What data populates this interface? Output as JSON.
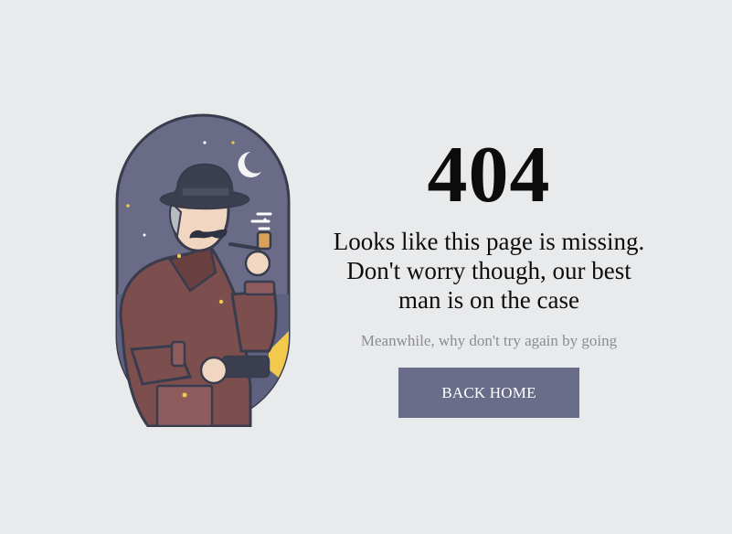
{
  "error": {
    "code": "404",
    "message_line1": "Looks like this page is missing.",
    "message_line2": "Don't worry though, our best",
    "message_line3": "man is on the case",
    "hint": "Meanwhile, why don't try again by going",
    "button_label": "BACK HOME"
  },
  "illustration": {
    "subject": "detective-with-pipe-and-flashlight",
    "colors": {
      "background": "#e9eaec",
      "night_sky": "#6a6c88",
      "coat": "#7d4f4f",
      "outline": "#3a3d4d",
      "button": "#6a6d8a"
    }
  }
}
